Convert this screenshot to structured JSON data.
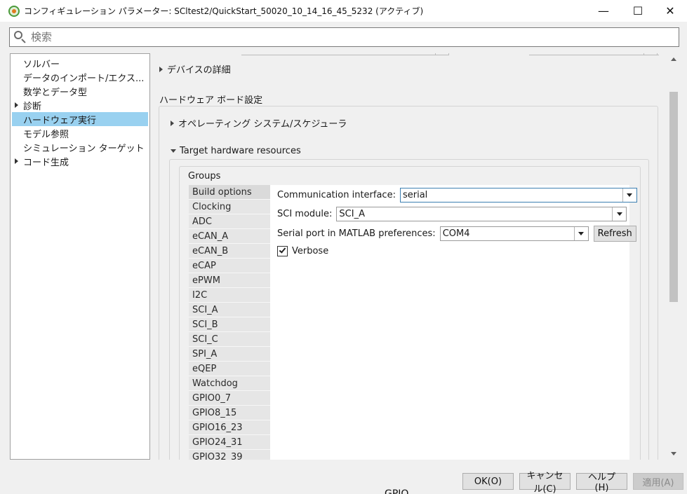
{
  "window": {
    "title": "コンフィギュレーション パラメーター: SCltest2/QuickStart_50020_10_14_16_45_5232 (アクティブ)",
    "controls": {
      "minimize": "—",
      "maximize": "☐",
      "close": "✕"
    }
  },
  "search": {
    "placeholder": "検索",
    "value": ""
  },
  "nav": {
    "items": [
      {
        "label": "ソルバー",
        "expandable": false,
        "selected": false
      },
      {
        "label": "データのインポート/エクス...",
        "expandable": false,
        "selected": false
      },
      {
        "label": "数学とデータ型",
        "expandable": false,
        "selected": false
      },
      {
        "label": "診断",
        "expandable": true,
        "selected": false
      },
      {
        "label": "ハードウェア実行",
        "expandable": false,
        "selected": true
      },
      {
        "label": "モデル参照",
        "expandable": false,
        "selected": false
      },
      {
        "label": "シミュレーション ターゲット",
        "expandable": false,
        "selected": false
      },
      {
        "label": "コード生成",
        "expandable": true,
        "selected": false
      }
    ]
  },
  "content": {
    "device_details": "デバイスの詳細",
    "hw_board_settings": "ハードウェア ボード設定",
    "os_scheduler": "オペレーティング システム/スケジューラ",
    "target_hw_resources": "Target hardware resources",
    "groups_label": "Groups",
    "groups": [
      "Build options",
      "Clocking",
      "ADC",
      "eCAN_A",
      "eCAN_B",
      "eCAP",
      "ePWM",
      "I2C",
      "SCI_A",
      "SCI_B",
      "SCI_C",
      "SPI_A",
      "eQEP",
      "Watchdog",
      "GPIO0_7",
      "GPIO8_15",
      "GPIO16_23",
      "GPIO24_31",
      "GPIO32_39"
    ],
    "active_group": "Build options",
    "fields": {
      "comm_interface_label": "Communication interface:",
      "comm_interface_value": "serial",
      "sci_module_label": "SCI module:",
      "sci_module_value": "SCI_A",
      "serial_port_label": "Serial port in MATLAB preferences:",
      "serial_port_value": "COM4",
      "refresh_label": "Refresh",
      "verbose_label": "Verbose",
      "verbose_checked": true
    }
  },
  "footer": {
    "ok": "OK(O)",
    "cancel": "キャンセル(C)",
    "help": "ヘルプ(H)",
    "apply": "適用(A)"
  },
  "background_fragment": "GPIO"
}
